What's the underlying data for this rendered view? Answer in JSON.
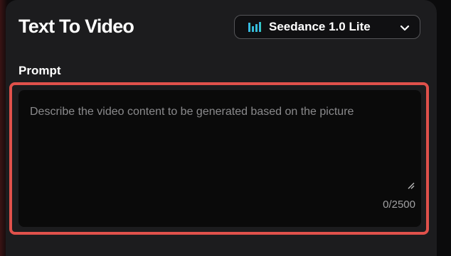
{
  "header": {
    "title": "Text To Video"
  },
  "model_select": {
    "selected": "Seedance 1.0 Lite",
    "icon": "audio-bars-icon",
    "dropdown_icon": "chevron-down-icon"
  },
  "prompt": {
    "label": "Prompt",
    "value": "",
    "placeholder": "Describe the video content to be generated based on the picture",
    "counter": "0/2500"
  },
  "colors": {
    "panel_bg": "#1c1c1e",
    "input_bg": "#0a0a0a",
    "highlight": "#e0514b",
    "icon_gradient_start": "#3aa0ff",
    "icon_gradient_end": "#33d6b0"
  }
}
